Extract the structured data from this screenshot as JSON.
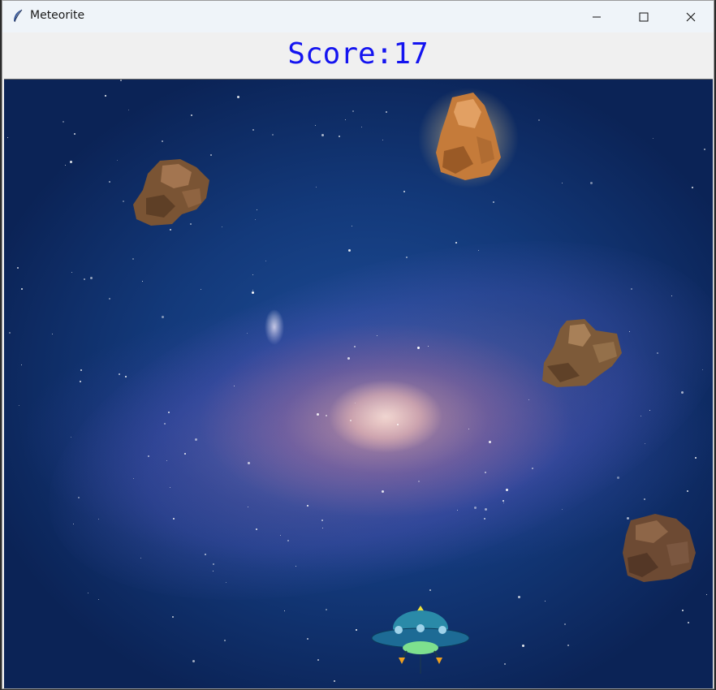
{
  "window": {
    "title": "Meteorite"
  },
  "hud": {
    "score_text": "Score:17",
    "score": 17,
    "score_color": "#1414f0"
  },
  "colors": {
    "titlebar_bg": "#eff4f9",
    "space_deep": "#0b2356",
    "space_mid": "#1f4f9a"
  },
  "icons": {
    "app": "feather-icon",
    "minimize": "minimize-icon",
    "maximize": "maximize-icon",
    "close": "close-icon"
  },
  "sprites": {
    "meteors": 4,
    "player": "ufo-spaceship"
  }
}
